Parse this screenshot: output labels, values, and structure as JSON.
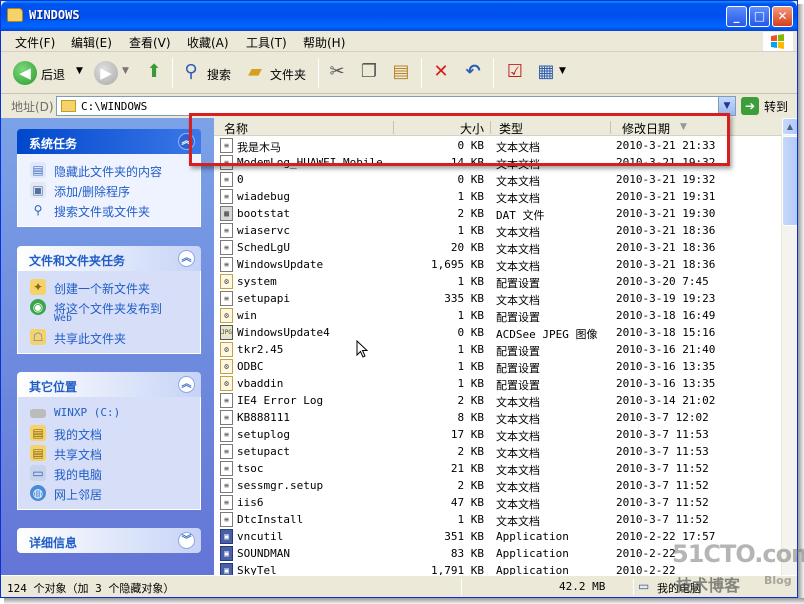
{
  "window": {
    "title": "WINDOWS"
  },
  "title_buttons": {
    "minimize": "_",
    "maximize": "□",
    "close": "✕"
  },
  "menu": [
    {
      "label": "文件(F)"
    },
    {
      "label": "编辑(E)"
    },
    {
      "label": "查看(V)"
    },
    {
      "label": "收藏(A)"
    },
    {
      "label": "工具(T)"
    },
    {
      "label": "帮助(H)"
    }
  ],
  "toolbar": {
    "back_label": "后退",
    "search_label": "搜索",
    "folders_label": "文件夹"
  },
  "address": {
    "label": "地址(D)",
    "value": "C:\\WINDOWS",
    "go_label": "转到"
  },
  "panels": {
    "system": {
      "title": "系统任务",
      "items": [
        "隐藏此文件夹的内容",
        "添加/删除程序",
        "搜索文件或文件夹"
      ]
    },
    "file": {
      "title": "文件和文件夹任务",
      "items": [
        "创建一个新文件夹",
        "将这个文件夹发布到",
        "共享此文件夹"
      ],
      "item2_line2": "Web"
    },
    "other": {
      "title": "其它位置",
      "items": [
        "WINXP (C:)",
        "我的文档",
        "共享文档",
        "我的电脑",
        "网上邻居"
      ]
    },
    "details": {
      "title": "详细信息"
    }
  },
  "columns": {
    "name": "名称",
    "size": "大小",
    "type": "类型",
    "date": "修改日期"
  },
  "files": [
    {
      "name": "我是木马",
      "size": "0 KB",
      "type": "文本文档",
      "date": "2010-3-21 21:33",
      "icon": "txt"
    },
    {
      "name": "ModemLog_HUAWEI Mobile…",
      "size": "14 KB",
      "type": "文本文档",
      "date": "2010-3-21 19:32",
      "icon": "txt"
    },
    {
      "name": "0",
      "size": "0 KB",
      "type": "文本文档",
      "date": "2010-3-21 19:32",
      "icon": "txt"
    },
    {
      "name": "wiadebug",
      "size": "1 KB",
      "type": "文本文档",
      "date": "2010-3-21 19:31",
      "icon": "txt"
    },
    {
      "name": "bootstat",
      "size": "2 KB",
      "type": "DAT 文件",
      "date": "2010-3-21 19:30",
      "icon": "dat"
    },
    {
      "name": "wiaservc",
      "size": "1 KB",
      "type": "文本文档",
      "date": "2010-3-21 18:36",
      "icon": "txt"
    },
    {
      "name": "SchedLgU",
      "size": "20 KB",
      "type": "文本文档",
      "date": "2010-3-21 18:36",
      "icon": "txt"
    },
    {
      "name": "WindowsUpdate",
      "size": "1,695 KB",
      "type": "文本文档",
      "date": "2010-3-21 18:36",
      "icon": "txt"
    },
    {
      "name": "system",
      "size": "1 KB",
      "type": "配置设置",
      "date": "2010-3-20 7:45",
      "icon": "cfg"
    },
    {
      "name": "setupapi",
      "size": "335 KB",
      "type": "文本文档",
      "date": "2010-3-19 19:23",
      "icon": "txt"
    },
    {
      "name": "win",
      "size": "1 KB",
      "type": "配置设置",
      "date": "2010-3-18 16:49",
      "icon": "cfg"
    },
    {
      "name": "WindowsUpdate4",
      "size": "0 KB",
      "type": "ACDSee JPEG 图像",
      "date": "2010-3-18 15:16",
      "icon": "jpg"
    },
    {
      "name": "tkr2.45",
      "size": "1 KB",
      "type": "配置设置",
      "date": "2010-3-16 21:40",
      "icon": "cfg"
    },
    {
      "name": "ODBC",
      "size": "1 KB",
      "type": "配置设置",
      "date": "2010-3-16 13:35",
      "icon": "cfg"
    },
    {
      "name": "vbaddin",
      "size": "1 KB",
      "type": "配置设置",
      "date": "2010-3-16 13:35",
      "icon": "cfg"
    },
    {
      "name": "IE4 Error Log",
      "size": "2 KB",
      "type": "文本文档",
      "date": "2010-3-14 21:02",
      "icon": "txt"
    },
    {
      "name": "KB888111",
      "size": "8 KB",
      "type": "文本文档",
      "date": "2010-3-7 12:02",
      "icon": "txt"
    },
    {
      "name": "setuplog",
      "size": "17 KB",
      "type": "文本文档",
      "date": "2010-3-7 11:53",
      "icon": "txt"
    },
    {
      "name": "setupact",
      "size": "2 KB",
      "type": "文本文档",
      "date": "2010-3-7 11:53",
      "icon": "txt"
    },
    {
      "name": "tsoc",
      "size": "21 KB",
      "type": "文本文档",
      "date": "2010-3-7 11:52",
      "icon": "txt"
    },
    {
      "name": "sessmgr.setup",
      "size": "2 KB",
      "type": "文本文档",
      "date": "2010-3-7 11:52",
      "icon": "txt"
    },
    {
      "name": "iis6",
      "size": "47 KB",
      "type": "文本文档",
      "date": "2010-3-7 11:52",
      "icon": "txt"
    },
    {
      "name": "DtcInstall",
      "size": "1 KB",
      "type": "文本文档",
      "date": "2010-3-7 11:52",
      "icon": "txt"
    },
    {
      "name": "vncutil",
      "size": "351 KB",
      "type": "Application",
      "date": "2010-2-22 17:57",
      "icon": "app"
    },
    {
      "name": "SOUNDMAN",
      "size": "83 KB",
      "type": "Application",
      "date": "2010-2-22",
      "icon": "app"
    },
    {
      "name": "SkyTel",
      "size": "1,791 KB",
      "type": "Application",
      "date": "2010-2-22",
      "icon": "app"
    }
  ],
  "status": {
    "count": "124 个对象（加 3 个隐藏对象）",
    "size": "42.2 MB",
    "location": "我的电脑"
  },
  "watermark": {
    "line1": "51CTO.com",
    "line2": "技术博客",
    "line3": "Blog"
  },
  "colors": {
    "titlebar": "#0053ee",
    "highlight_box": "#d61f1f",
    "link": "#215dc6"
  }
}
